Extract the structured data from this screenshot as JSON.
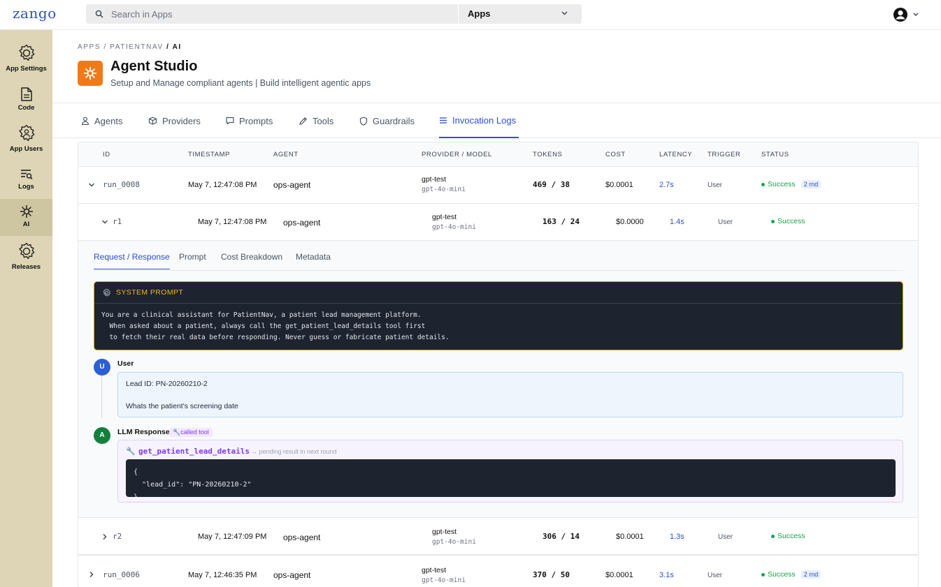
{
  "topbar": {
    "logo": "zango",
    "search_placeholder": "Search in Apps",
    "app_selector": "Apps"
  },
  "sidebar": {
    "items": [
      {
        "label": "App Settings",
        "icon": "gear-icon"
      },
      {
        "label": "Code",
        "icon": "file-code-icon"
      },
      {
        "label": "App Users",
        "icon": "users-gear-icon"
      },
      {
        "label": "Logs",
        "icon": "logs-search-icon"
      },
      {
        "label": "AI",
        "icon": "ai-sparkle-icon",
        "active": true
      },
      {
        "label": "Releases",
        "icon": "releases-gear-icon"
      }
    ]
  },
  "breadcrumb": {
    "part1": "APPS",
    "sep1": " / ",
    "part2": "PATIENTNAV",
    "sep2": " / ",
    "part3": "AI"
  },
  "header": {
    "title": "Agent Studio",
    "subtitle": "Setup and Manage compliant agents | Build intelligent agentic apps"
  },
  "tabs": [
    {
      "label": "Agents",
      "icon": "person-icon"
    },
    {
      "label": "Providers",
      "icon": "cube-icon"
    },
    {
      "label": "Prompts",
      "icon": "chat-icon"
    },
    {
      "label": "Tools",
      "icon": "pencil-icon"
    },
    {
      "label": "Guardrails",
      "icon": "shield-icon"
    },
    {
      "label": "Invocation Logs",
      "icon": "list-icon",
      "active": true
    }
  ],
  "table": {
    "columns": [
      "ID",
      "TIMESTAMP",
      "AGENT",
      "PROVIDER / MODEL",
      "TOKENS",
      "COST",
      "LATENCY",
      "TRIGGER",
      "STATUS"
    ],
    "rows": {
      "run8": {
        "id": "run_0008",
        "timestamp": "May 7, 12:47:08 PM",
        "agent": "ops-agent",
        "provider": "gpt-test",
        "model": "gpt-4o-mini",
        "tokens": "469 / 38",
        "cost": "$0.0001",
        "latency": "2.7s",
        "trigger": "User",
        "status": "Success",
        "rounds": "2 rnd"
      },
      "r1": {
        "id": "r1",
        "timestamp": "May 7, 12:47:08 PM",
        "agent": "ops-agent",
        "provider": "gpt-test",
        "model": "gpt-4o-mini",
        "tokens": "163 / 24",
        "cost": "$0.0000",
        "latency": "1.4s",
        "trigger": "User",
        "status": "Success"
      },
      "r2": {
        "id": "r2",
        "timestamp": "May 7, 12:47:09 PM",
        "agent": "ops-agent",
        "provider": "gpt-test",
        "model": "gpt-4o-mini",
        "tokens": "306 / 14",
        "cost": "$0.0001",
        "latency": "1.3s",
        "trigger": "User",
        "status": "Success"
      },
      "run6": {
        "id": "run_0006",
        "timestamp": "May 7, 12:46:35 PM",
        "agent": "ops-agent",
        "provider": "gpt-test",
        "model": "gpt-4o-mini",
        "tokens": "370 / 50",
        "cost": "$0.0001",
        "latency": "3.1s",
        "trigger": "User",
        "status": "Success",
        "rounds": "2 rnd"
      }
    }
  },
  "detail": {
    "tabs": [
      "Request / Response",
      "Prompt",
      "Cost Breakdown",
      "Metadata"
    ],
    "system_prompt": {
      "title": "SYSTEM PROMPT",
      "line1": "You are a clinical assistant for PatientNav, a patient lead management platform.",
      "line2": "  When asked about a patient, always call the get_patient_lead_details tool first",
      "line3": "  to fetch their real data before responding. Never guess or fabricate patient details."
    },
    "user": {
      "avatar": "U",
      "role": "User",
      "line1": "Lead ID: PN-20260210-2",
      "line2": "Whats the patient's screening date"
    },
    "llm": {
      "avatar": "A",
      "role": "LLM Response",
      "badge": "called tool",
      "tool_name": "get_patient_lead_details",
      "tool_note": "→ pending result in next round",
      "code1": "{",
      "code2": "  \"lead_id\": \"PN-20260210-2\"",
      "code3": "}"
    }
  },
  "colors": {
    "brand": "#2d4fc9",
    "sidebar": "#ddd5b5",
    "sidebar_active": "#cec6a1",
    "accent_orange": "#ef7a1a",
    "success": "#16a34a",
    "tool_purple": "#7c3aed",
    "system_border": "#d4a216"
  }
}
